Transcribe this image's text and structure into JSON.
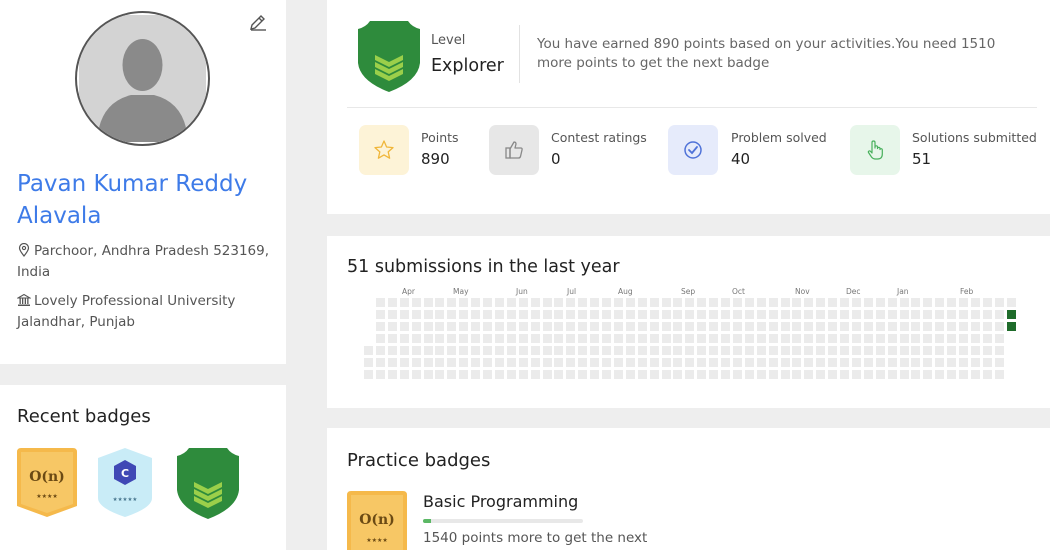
{
  "profile": {
    "name": "Pavan Kumar Reddy Alavala",
    "location": "Parchoor, Andhra Pradesh 523169, India",
    "institution": "Lovely Professional University Jalandhar, Punjab"
  },
  "recent_badges": {
    "title": "Recent badges",
    "items": [
      {
        "name": "O(n) badge",
        "text": "O(n)",
        "stars": "★★★★",
        "color": "#f5b94b"
      },
      {
        "name": "C badge",
        "text": "C",
        "stars": "★★★★★",
        "color": "#c9ecf7"
      },
      {
        "name": "Explorer badge",
        "color": "#2e8b3c"
      }
    ]
  },
  "level": {
    "label": "Level",
    "value": "Explorer",
    "description": "You have earned 890 points based on your activities.You need 1510 more points to get the next badge"
  },
  "stats": [
    {
      "name": "points",
      "label": "Points",
      "value": "890",
      "icon": "star-icon",
      "bg": "#fdf3d7",
      "fg": "#f0b63a"
    },
    {
      "name": "contest-ratings",
      "label": "Contest ratings",
      "value": "0",
      "icon": "thumbs-up-icon",
      "bg": "#e7e7e7",
      "fg": "#888888"
    },
    {
      "name": "problem-solved",
      "label": "Problem solved",
      "value": "40",
      "icon": "check-circle-icon",
      "bg": "#e6ebfb",
      "fg": "#4f72d8"
    },
    {
      "name": "solutions-submitted",
      "label": "Solutions submitted",
      "value": "51",
      "icon": "pointer-hand-icon",
      "bg": "#e7f6ea",
      "fg": "#48b05c"
    }
  ],
  "heatmap": {
    "title": "51 submissions in the last year",
    "months": [
      "Apr",
      "May",
      "Jun",
      "Jul",
      "Aug",
      "Sep",
      "Oct",
      "Nov",
      "Dec",
      "Jan",
      "Feb"
    ],
    "active_color": "#1e6b2a",
    "empty_color": "#ebebeb"
  },
  "practice": {
    "title": "Practice badges",
    "items": [
      {
        "name": "Basic Programming",
        "badge_text": "O(n)",
        "stars": "★★★★",
        "progress": 0.05,
        "note": "1540 points more to get the next"
      }
    ]
  }
}
